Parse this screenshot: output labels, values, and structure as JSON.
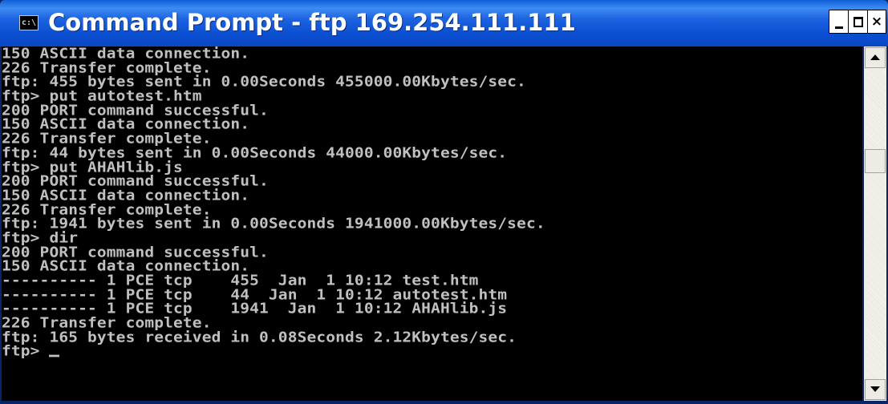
{
  "window": {
    "title": "Command Prompt - ftp 169.254.111.111",
    "icon_name": "console-app-icon",
    "icon_glyph": "c:\\"
  },
  "controls": {
    "minimize_icon": "minimize-icon",
    "maximize_icon": "maximize-icon",
    "close_glyph": "×"
  },
  "console": {
    "lines": [
      "150 ASCII data connection.",
      "226 Transfer complete.",
      "ftp: 455 bytes sent in 0.00Seconds 455000.00Kbytes/sec.",
      "ftp> put autotest.htm",
      "200 PORT command successful.",
      "150 ASCII data connection.",
      "226 Transfer complete.",
      "ftp: 44 bytes sent in 0.00Seconds 44000.00Kbytes/sec.",
      "ftp> put AHAHlib.js",
      "200 PORT command successful.",
      "150 ASCII data connection.",
      "226 Transfer complete.",
      "ftp: 1941 bytes sent in 0.00Seconds 1941000.00Kbytes/sec.",
      "ftp> dir",
      "200 PORT command successful.",
      "150 ASCII data connection.",
      "---------- 1 PCE tcp    455  Jan  1 10:12 test.htm",
      "---------- 1 PCE tcp    44  Jan  1 10:12 autotest.htm",
      "---------- 1 PCE tcp    1941  Jan  1 10:12 AHAHlib.js",
      "226 Transfer complete.",
      "ftp: 165 bytes received in 0.08Seconds 2.12Kbytes/sec.",
      "ftp> "
    ]
  },
  "colors": {
    "titlebar": "#0a4ed0",
    "console_bg": "#000000",
    "console_text": "#c0c0c0"
  }
}
